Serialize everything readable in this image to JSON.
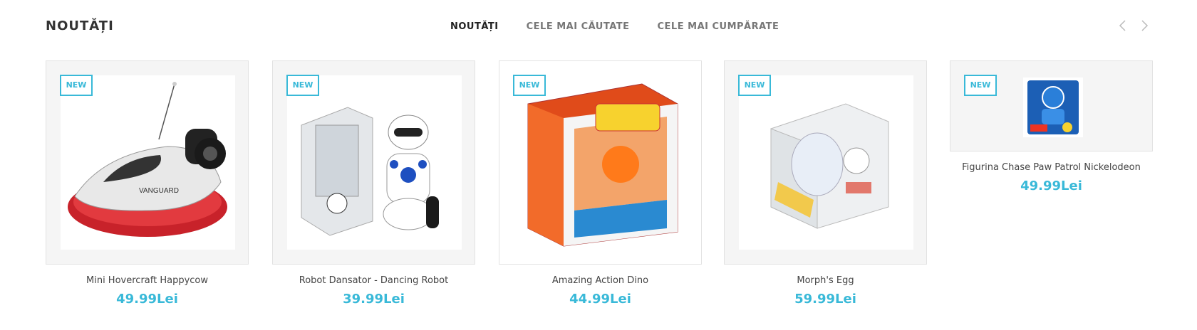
{
  "section": {
    "title": "NOUTĂȚI"
  },
  "tabs": [
    {
      "label": "NOUTĂȚI",
      "active": true
    },
    {
      "label": "CELE MAI CĂUTATE",
      "active": false
    },
    {
      "label": "CELE MAI CUMPĂRATE",
      "active": false
    }
  ],
  "nav": {
    "prev_icon": "chevron-left-icon",
    "next_icon": "chevron-right-icon"
  },
  "products": [
    {
      "badge": "NEW",
      "name": "Mini Hovercraft Happycow",
      "price": "49.99Lei",
      "image": "hovercraft-image"
    },
    {
      "badge": "NEW",
      "name": "Robot Dansator - Dancing Robot",
      "price": "39.99Lei",
      "image": "robot-image"
    },
    {
      "badge": "NEW",
      "name": "Amazing Action Dino",
      "price": "44.99Lei",
      "image": "dino-box-image"
    },
    {
      "badge": "NEW",
      "name": "Morph's Egg",
      "price": "59.99Lei",
      "image": "egg-puzzle-image"
    },
    {
      "badge": "NEW",
      "name": "Figurina Chase Paw Patrol Nickelodeon",
      "price": "49.99Lei",
      "image": "paw-patrol-image"
    }
  ],
  "colors": {
    "accent": "#39b9d8",
    "title": "#333333",
    "tab_inactive": "#777777"
  }
}
